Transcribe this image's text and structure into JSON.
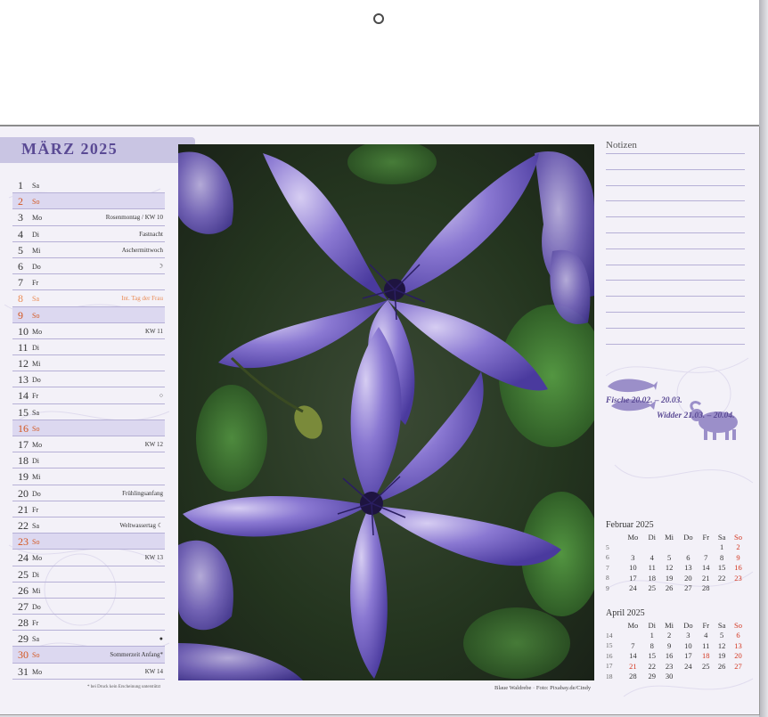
{
  "month_title": "MÄRZ 2025",
  "days": [
    {
      "num": "1",
      "wd": "Sa",
      "note": "",
      "type": "normal"
    },
    {
      "num": "2",
      "wd": "So",
      "note": "",
      "type": "sun"
    },
    {
      "num": "3",
      "wd": "Mo",
      "note": "Rosenmontag / KW 10",
      "type": "normal"
    },
    {
      "num": "4",
      "wd": "Di",
      "note": "Fastnacht",
      "type": "normal"
    },
    {
      "num": "5",
      "wd": "Mi",
      "note": "Aschermittwoch",
      "type": "normal"
    },
    {
      "num": "6",
      "wd": "Do",
      "note": "☽",
      "type": "normal"
    },
    {
      "num": "7",
      "wd": "Fr",
      "note": "",
      "type": "normal"
    },
    {
      "num": "8",
      "wd": "Sa",
      "note": "Int. Tag der Frau",
      "type": "sat-holiday"
    },
    {
      "num": "9",
      "wd": "So",
      "note": "",
      "type": "sun"
    },
    {
      "num": "10",
      "wd": "Mo",
      "note": "KW 11",
      "type": "normal"
    },
    {
      "num": "11",
      "wd": "Di",
      "note": "",
      "type": "normal"
    },
    {
      "num": "12",
      "wd": "Mi",
      "note": "",
      "type": "normal"
    },
    {
      "num": "13",
      "wd": "Do",
      "note": "",
      "type": "normal"
    },
    {
      "num": "14",
      "wd": "Fr",
      "note": "○",
      "type": "normal"
    },
    {
      "num": "15",
      "wd": "Sa",
      "note": "",
      "type": "normal"
    },
    {
      "num": "16",
      "wd": "So",
      "note": "",
      "type": "sun"
    },
    {
      "num": "17",
      "wd": "Mo",
      "note": "KW 12",
      "type": "normal"
    },
    {
      "num": "18",
      "wd": "Di",
      "note": "",
      "type": "normal"
    },
    {
      "num": "19",
      "wd": "Mi",
      "note": "",
      "type": "normal"
    },
    {
      "num": "20",
      "wd": "Do",
      "note": "Frühlingsanfang",
      "type": "normal"
    },
    {
      "num": "21",
      "wd": "Fr",
      "note": "",
      "type": "normal"
    },
    {
      "num": "22",
      "wd": "Sa",
      "note": "Weltwassertag  ☾",
      "type": "normal"
    },
    {
      "num": "23",
      "wd": "So",
      "note": "",
      "type": "sun"
    },
    {
      "num": "24",
      "wd": "Mo",
      "note": "KW 13",
      "type": "normal"
    },
    {
      "num": "25",
      "wd": "Di",
      "note": "",
      "type": "normal"
    },
    {
      "num": "26",
      "wd": "Mi",
      "note": "",
      "type": "normal"
    },
    {
      "num": "27",
      "wd": "Do",
      "note": "",
      "type": "normal"
    },
    {
      "num": "28",
      "wd": "Fr",
      "note": "",
      "type": "normal"
    },
    {
      "num": "29",
      "wd": "Sa",
      "note": "●",
      "type": "normal"
    },
    {
      "num": "30",
      "wd": "So",
      "note": "Sommerzeit Anfang*",
      "type": "sun"
    },
    {
      "num": "31",
      "wd": "Mo",
      "note": "KW 14",
      "type": "normal"
    }
  ],
  "footnote": "* bei Druck kein Erscheinung unterstützt",
  "photo_credit": "Blaue Waldrebe · Foto: Pixabay.de/Cindy",
  "notes_title": "Notizen",
  "zodiac": {
    "pisces": "Fische 20.02. – 20.03.",
    "aries": "Widder 21.03. – 20.04.",
    "color": "#9b8fc9"
  },
  "mini_calendars": [
    {
      "title": "Februar 2025",
      "headers": [
        "",
        "Mo",
        "Di",
        "Mi",
        "Do",
        "Fr",
        "Sa",
        "So"
      ],
      "rows": [
        [
          "5",
          "",
          "",
          "",
          "",
          "",
          "1",
          "2"
        ],
        [
          "6",
          "3",
          "4",
          "5",
          "6",
          "7",
          "8",
          "9"
        ],
        [
          "7",
          "10",
          "11",
          "12",
          "13",
          "14",
          "15",
          "16"
        ],
        [
          "8",
          "17",
          "18",
          "19",
          "20",
          "21",
          "22",
          "23"
        ],
        [
          "9",
          "24",
          "25",
          "26",
          "27",
          "28",
          "",
          ""
        ]
      ],
      "holidays": []
    },
    {
      "title": "April 2025",
      "headers": [
        "",
        "Mo",
        "Di",
        "Mi",
        "Do",
        "Fr",
        "Sa",
        "So"
      ],
      "rows": [
        [
          "14",
          "",
          "1",
          "2",
          "3",
          "4",
          "5",
          "6"
        ],
        [
          "15",
          "7",
          "8",
          "9",
          "10",
          "11",
          "12",
          "13"
        ],
        [
          "16",
          "14",
          "15",
          "16",
          "17",
          "18",
          "19",
          "20"
        ],
        [
          "17",
          "21",
          "22",
          "23",
          "24",
          "25",
          "26",
          "27"
        ],
        [
          "18",
          "28",
          "29",
          "30",
          "",
          "",
          "",
          ""
        ]
      ],
      "holidays": [
        "18",
        "21"
      ]
    }
  ],
  "colors": {
    "accent": "#5a4a94",
    "banner": "#c9c5e3",
    "sunday": "#d3561f",
    "line": "#b6b0d6"
  }
}
